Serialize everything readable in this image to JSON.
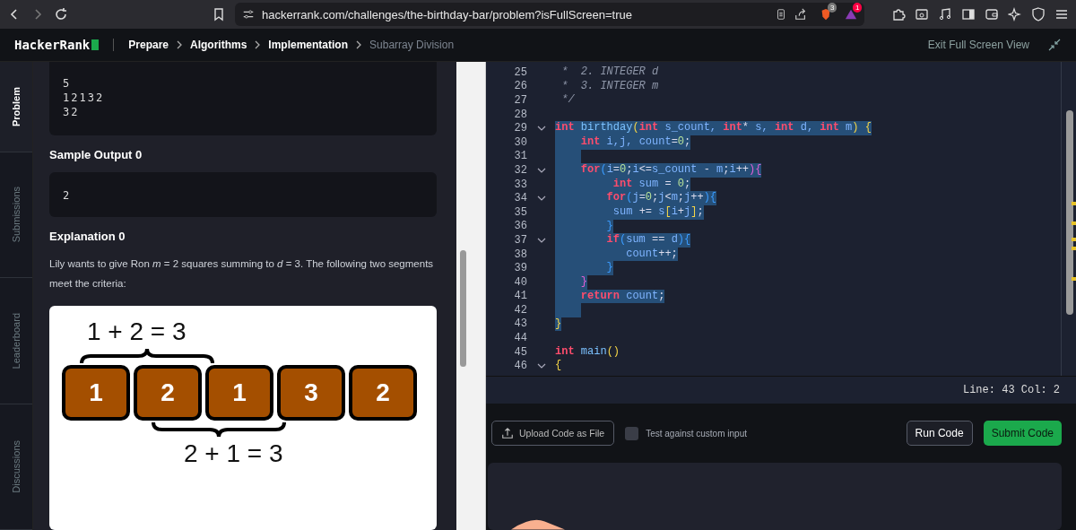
{
  "browser": {
    "url": "hackerrank.com/challenges/the-birthday-bar/problem?isFullScreen=true",
    "shield_badge": "3",
    "rewards_badge": "1"
  },
  "header": {
    "logo": "HackerRank",
    "breadcrumbs": [
      {
        "label": "Prepare",
        "current": false
      },
      {
        "label": "Algorithms",
        "current": false
      },
      {
        "label": "Implementation",
        "current": false
      },
      {
        "label": "Subarray Division",
        "current": true
      }
    ],
    "exit_label": "Exit Full Screen View"
  },
  "side_tabs": [
    {
      "label": "Problem",
      "selected": true
    },
    {
      "label": "Submissions",
      "selected": false
    },
    {
      "label": "Leaderboard",
      "selected": false
    },
    {
      "label": "Discussions",
      "selected": false
    }
  ],
  "problem": {
    "sample_input_lines": [
      "5",
      "12132",
      "32"
    ],
    "output_heading": "Sample Output 0",
    "sample_output": "2",
    "explanation_heading": "Explanation 0",
    "explanation": "Lily wants to give Ron *m* = 2 squares summing to *d* = 3. The following two segments meet the criteria:",
    "figure": {
      "top_equation": "1 + 2 = 3",
      "squares": [
        "1",
        "2",
        "1",
        "3",
        "2"
      ],
      "bottom_equation": "2 + 1 = 3"
    }
  },
  "editor": {
    "lines": [
      {
        "number": "25",
        "fold": false,
        "selected": false,
        "tokens": [
          {
            "kind": "cm",
            "text": " *  2. INTEGER d"
          }
        ]
      },
      {
        "number": "26",
        "fold": false,
        "selected": false,
        "tokens": [
          {
            "kind": "cm",
            "text": " *  3. INTEGER m"
          }
        ]
      },
      {
        "number": "27",
        "fold": false,
        "selected": false,
        "tokens": [
          {
            "kind": "cm",
            "text": " */"
          }
        ]
      },
      {
        "number": "28",
        "fold": false
      },
      {
        "number": "29",
        "fold": true,
        "selected": true,
        "tokens": [
          {
            "kind": "kw",
            "text": "int"
          },
          {
            "kind": "fn",
            "text": " birthday"
          },
          {
            "kind": "br",
            "text": "("
          },
          {
            "kind": "kw",
            "text": "int"
          },
          {
            "kind": "id",
            "text": " s_count, "
          },
          {
            "kind": "kw",
            "text": "int"
          },
          {
            "kind": "op",
            "text": "*"
          },
          {
            "kind": "id",
            "text": " s, "
          },
          {
            "kind": "kw",
            "text": "int"
          },
          {
            "kind": "id",
            "text": " d, "
          },
          {
            "kind": "kw",
            "text": "int"
          },
          {
            "kind": "id",
            "text": " m"
          },
          {
            "kind": "br",
            "text": ") {"
          }
        ]
      },
      {
        "number": "30",
        "fold": false,
        "selected": true,
        "tokens": [
          {
            "kind": "kw",
            "text": "    int"
          },
          {
            "kind": "id",
            "text": " i,j, count"
          },
          {
            "kind": "op",
            "text": "="
          },
          {
            "kind": "num",
            "text": "0"
          },
          {
            "kind": "op",
            "text": ";"
          }
        ]
      },
      {
        "number": "31",
        "fold": false,
        "selected": true
      },
      {
        "number": "32",
        "fold": true,
        "selected": true,
        "tokens": [
          {
            "kind": "kw",
            "text": "    for"
          },
          {
            "kind": "b2",
            "text": "("
          },
          {
            "kind": "id",
            "text": "i"
          },
          {
            "kind": "op",
            "text": "="
          },
          {
            "kind": "num",
            "text": "0"
          },
          {
            "kind": "op",
            "text": ";"
          },
          {
            "kind": "id",
            "text": "i"
          },
          {
            "kind": "op",
            "text": "<="
          },
          {
            "kind": "id",
            "text": "s_count "
          },
          {
            "kind": "op",
            "text": "- "
          },
          {
            "kind": "id",
            "text": "m"
          },
          {
            "kind": "op",
            "text": ";"
          },
          {
            "kind": "id",
            "text": "i"
          },
          {
            "kind": "op",
            "text": "++"
          },
          {
            "kind": "b3",
            "text": "){"
          }
        ]
      },
      {
        "number": "33",
        "fold": false,
        "selected": true,
        "tokens": [
          {
            "kind": "kw",
            "text": "         int"
          },
          {
            "kind": "id",
            "text": " sum "
          },
          {
            "kind": "op",
            "text": "= "
          },
          {
            "kind": "num",
            "text": "0"
          },
          {
            "kind": "op",
            "text": ";"
          }
        ]
      },
      {
        "number": "34",
        "fold": true,
        "selected": true,
        "tokens": [
          {
            "kind": "kw",
            "text": "        for"
          },
          {
            "kind": "b2",
            "text": "("
          },
          {
            "kind": "id",
            "text": "j"
          },
          {
            "kind": "op",
            "text": "="
          },
          {
            "kind": "num",
            "text": "0"
          },
          {
            "kind": "op",
            "text": ";"
          },
          {
            "kind": "id",
            "text": "j"
          },
          {
            "kind": "op",
            "text": "<"
          },
          {
            "kind": "id",
            "text": "m"
          },
          {
            "kind": "op",
            "text": ";"
          },
          {
            "kind": "id",
            "text": "j"
          },
          {
            "kind": "op",
            "text": "++"
          },
          {
            "kind": "b2",
            "text": "){"
          }
        ]
      },
      {
        "number": "35",
        "fold": false,
        "selected": true,
        "tokens": [
          {
            "kind": "id",
            "text": "         sum "
          },
          {
            "kind": "op",
            "text": "+= "
          },
          {
            "kind": "id",
            "text": "s"
          },
          {
            "kind": "br",
            "text": "["
          },
          {
            "kind": "id",
            "text": "i"
          },
          {
            "kind": "op",
            "text": "+"
          },
          {
            "kind": "id",
            "text": "j"
          },
          {
            "kind": "br",
            "text": "]"
          },
          {
            "kind": "op",
            "text": ";"
          }
        ]
      },
      {
        "number": "36",
        "fold": false,
        "selected": true,
        "tokens": [
          {
            "kind": "b2",
            "text": "        }"
          }
        ]
      },
      {
        "number": "37",
        "fold": true,
        "selected": true,
        "tokens": [
          {
            "kind": "kw",
            "text": "        if"
          },
          {
            "kind": "b2",
            "text": "("
          },
          {
            "kind": "id",
            "text": "sum "
          },
          {
            "kind": "op",
            "text": "== "
          },
          {
            "kind": "id",
            "text": "d"
          },
          {
            "kind": "b2",
            "text": "){"
          }
        ]
      },
      {
        "number": "38",
        "fold": false,
        "selected": true,
        "tokens": [
          {
            "kind": "id",
            "text": "           count"
          },
          {
            "kind": "op",
            "text": "++;"
          }
        ]
      },
      {
        "number": "39",
        "fold": false,
        "selected": true,
        "tokens": [
          {
            "kind": "b2",
            "text": "        }"
          }
        ]
      },
      {
        "number": "40",
        "fold": false,
        "selected": true,
        "tokens": [
          {
            "kind": "b3",
            "text": "    }"
          }
        ]
      },
      {
        "number": "41",
        "fold": false,
        "selected": true,
        "tokens": [
          {
            "kind": "kw",
            "text": "    return"
          },
          {
            "kind": "id",
            "text": " count"
          },
          {
            "kind": "op",
            "text": ";"
          }
        ]
      },
      {
        "number": "42",
        "fold": false,
        "selected": true
      },
      {
        "number": "43",
        "fold": false,
        "selected": true,
        "tokens": [
          {
            "kind": "br",
            "text": "}"
          }
        ]
      },
      {
        "number": "44",
        "fold": false
      },
      {
        "number": "45",
        "fold": false,
        "selected": false,
        "tokens": [
          {
            "kind": "kw",
            "text": "int"
          },
          {
            "kind": "fn",
            "text": " main"
          },
          {
            "kind": "br",
            "text": "()"
          }
        ]
      },
      {
        "number": "46",
        "fold": true,
        "selected": false,
        "tokens": [
          {
            "kind": "br",
            "text": "{"
          }
        ]
      }
    ],
    "status": "Line: 43 Col: 2"
  },
  "actions": {
    "upload": "Upload Code as File",
    "custom_input": {
      "label": "Test against custom input",
      "checked": false
    },
    "run": "Run Code",
    "submit": "Submit Code"
  }
}
